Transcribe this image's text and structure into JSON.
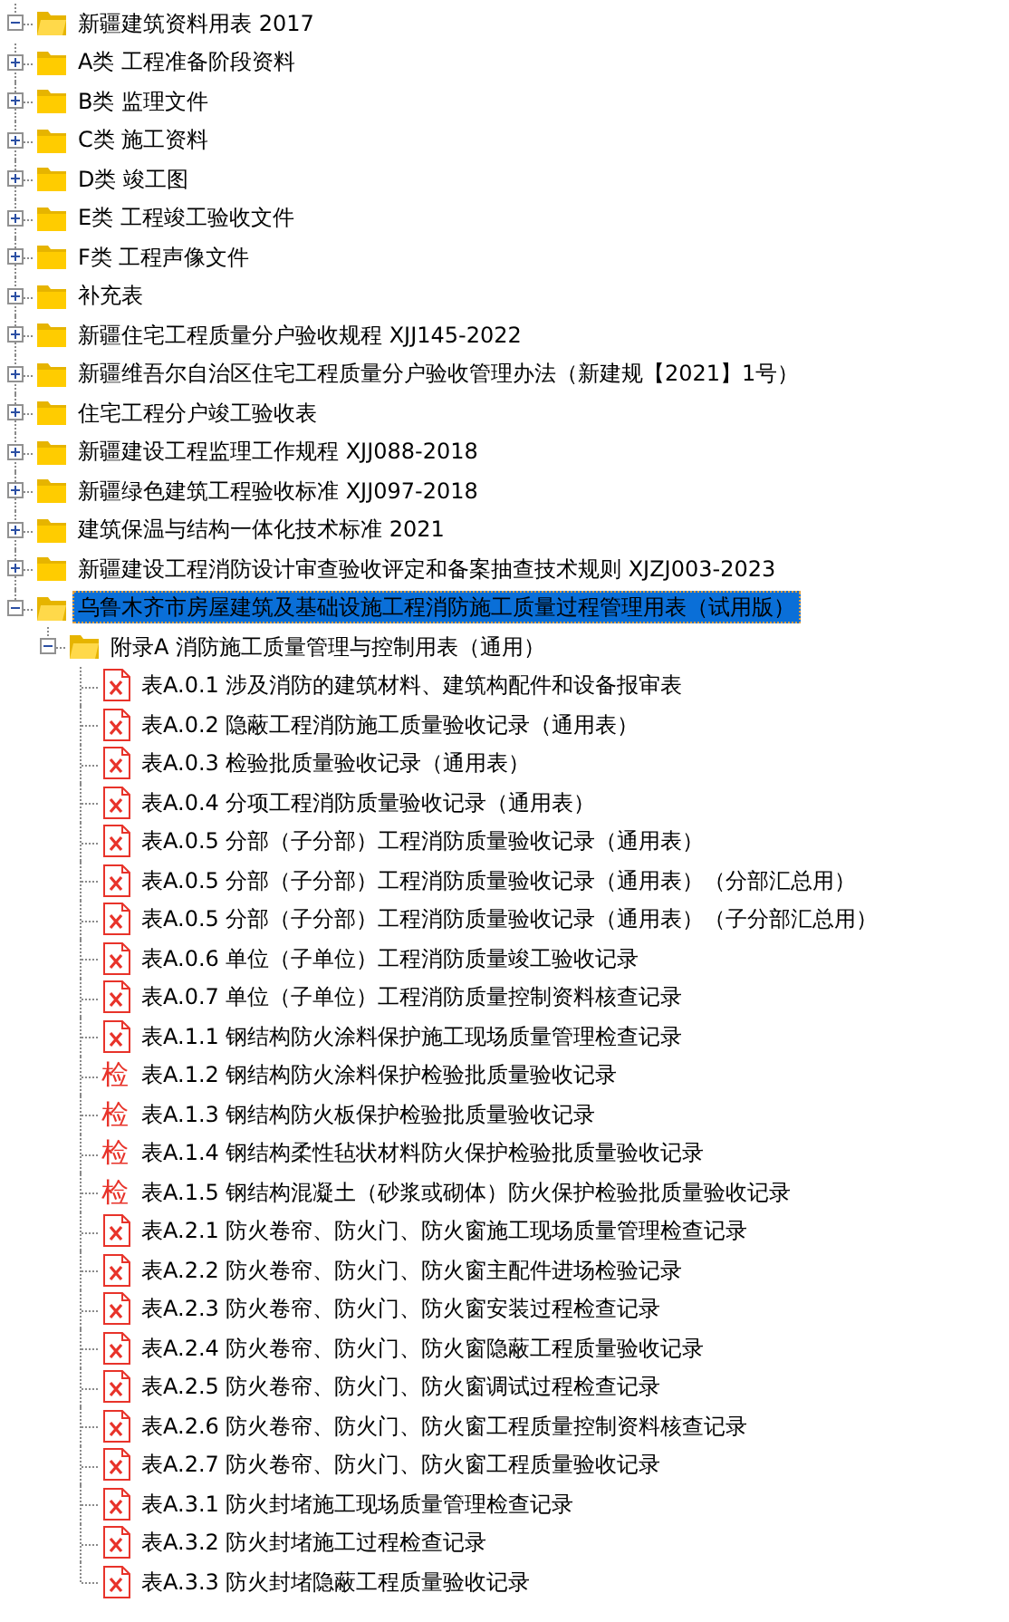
{
  "tree": {
    "label": "新疆建筑资料用表 2017",
    "kind": "folder",
    "expanded": true,
    "selected": false,
    "children": [
      {
        "label": "A类 工程准备阶段资料",
        "kind": "folder",
        "expanded": false,
        "selected": false
      },
      {
        "label": "B类 监理文件",
        "kind": "folder",
        "expanded": false,
        "selected": false
      },
      {
        "label": "C类 施工资料",
        "kind": "folder",
        "expanded": false,
        "selected": false
      },
      {
        "label": "D类 竣工图",
        "kind": "folder",
        "expanded": false,
        "selected": false
      },
      {
        "label": "E类 工程竣工验收文件",
        "kind": "folder",
        "expanded": false,
        "selected": false
      },
      {
        "label": "F类 工程声像文件",
        "kind": "folder",
        "expanded": false,
        "selected": false
      },
      {
        "label": "补充表",
        "kind": "folder",
        "expanded": false,
        "selected": false
      },
      {
        "label": "新疆住宅工程质量分户验收规程 XJJ145-2022",
        "kind": "folder",
        "expanded": false,
        "selected": false
      },
      {
        "label": "新疆维吾尔自治区住宅工程质量分户验收管理办法（新建规【2021】1号）",
        "kind": "folder",
        "expanded": false,
        "selected": false
      },
      {
        "label": "住宅工程分户竣工验收表",
        "kind": "folder",
        "expanded": false,
        "selected": false
      },
      {
        "label": "新疆建设工程监理工作规程 XJJ088-2018",
        "kind": "folder",
        "expanded": false,
        "selected": false
      },
      {
        "label": "新疆绿色建筑工程验收标准 XJJ097-2018",
        "kind": "folder",
        "expanded": false,
        "selected": false
      },
      {
        "label": "建筑保温与结构一体化技术标准 2021",
        "kind": "folder",
        "expanded": false,
        "selected": false
      },
      {
        "label": "新疆建设工程消防设计审查验收评定和备案抽查技术规则 XJZJ003-2023",
        "kind": "folder",
        "expanded": false,
        "selected": false
      },
      {
        "label": "乌鲁木齐市房屋建筑及基础设施工程消防施工质量过程管理用表（试用版）",
        "kind": "folder",
        "expanded": true,
        "selected": true,
        "children": [
          {
            "label": "附录A 消防施工质量管理与控制用表（通用）",
            "kind": "folder",
            "expanded": true,
            "selected": false,
            "children": [
              {
                "label": "表A.0.1 涉及消防的建筑材料、建筑构配件和设备报审表",
                "kind": "sheet",
                "selected": false
              },
              {
                "label": "表A.0.2 隐蔽工程消防施工质量验收记录（通用表）",
                "kind": "sheet",
                "selected": false
              },
              {
                "label": "表A.0.3 检验批质量验收记录（通用表）",
                "kind": "sheet",
                "selected": false
              },
              {
                "label": "表A.0.4 分项工程消防质量验收记录（通用表）",
                "kind": "sheet",
                "selected": false
              },
              {
                "label": "表A.0.5 分部（子分部）工程消防质量验收记录（通用表）",
                "kind": "sheet",
                "selected": false
              },
              {
                "label": "表A.0.5 分部（子分部）工程消防质量验收记录（通用表）（分部汇总用）",
                "kind": "sheet",
                "selected": false
              },
              {
                "label": "表A.0.5 分部（子分部）工程消防质量验收记录（通用表）（子分部汇总用）",
                "kind": "sheet",
                "selected": false
              },
              {
                "label": "表A.0.6 单位（子单位）工程消防质量竣工验收记录",
                "kind": "sheet",
                "selected": false
              },
              {
                "label": "表A.0.7 单位（子单位）工程消防质量控制资料核查记录",
                "kind": "sheet",
                "selected": false
              },
              {
                "label": "表A.1.1 钢结构防火涂料保护施工现场质量管理检查记录",
                "kind": "sheet",
                "selected": false
              },
              {
                "label": "表A.1.2 钢结构防火涂料保护检验批质量验收记录",
                "kind": "inspect",
                "badge": "检",
                "selected": false
              },
              {
                "label": "表A.1.3 钢结构防火板保护检验批质量验收记录",
                "kind": "inspect",
                "badge": "检",
                "selected": false
              },
              {
                "label": "表A.1.4 钢结构柔性毡状材料防火保护检验批质量验收记录",
                "kind": "inspect",
                "badge": "检",
                "selected": false
              },
              {
                "label": "表A.1.5 钢结构混凝土（砂浆或砌体）防火保护检验批质量验收记录",
                "kind": "inspect",
                "badge": "检",
                "selected": false
              },
              {
                "label": "表A.2.1 防火卷帘、防火门、防火窗施工现场质量管理检查记录",
                "kind": "sheet",
                "selected": false
              },
              {
                "label": "表A.2.2 防火卷帘、防火门、防火窗主配件进场检验记录",
                "kind": "sheet",
                "selected": false
              },
              {
                "label": "表A.2.3 防火卷帘、防火门、防火窗安装过程检查记录",
                "kind": "sheet",
                "selected": false
              },
              {
                "label": "表A.2.4 防火卷帘、防火门、防火窗隐蔽工程质量验收记录",
                "kind": "sheet",
                "selected": false
              },
              {
                "label": "表A.2.5 防火卷帘、防火门、防火窗调试过程检查记录",
                "kind": "sheet",
                "selected": false
              },
              {
                "label": "表A.2.6 防火卷帘、防火门、防火窗工程质量控制资料核查记录",
                "kind": "sheet",
                "selected": false
              },
              {
                "label": "表A.2.7 防火卷帘、防火门、防火窗工程质量验收记录",
                "kind": "sheet",
                "selected": false
              },
              {
                "label": "表A.3.1 防火封堵施工现场质量管理检查记录",
                "kind": "sheet",
                "selected": false
              },
              {
                "label": "表A.3.2 防火封堵施工过程检查记录",
                "kind": "sheet",
                "selected": false
              },
              {
                "label": "表A.3.3 防火封堵隐蔽工程质量验收记录",
                "kind": "sheet",
                "selected": false
              }
            ]
          }
        ]
      }
    ]
  }
}
